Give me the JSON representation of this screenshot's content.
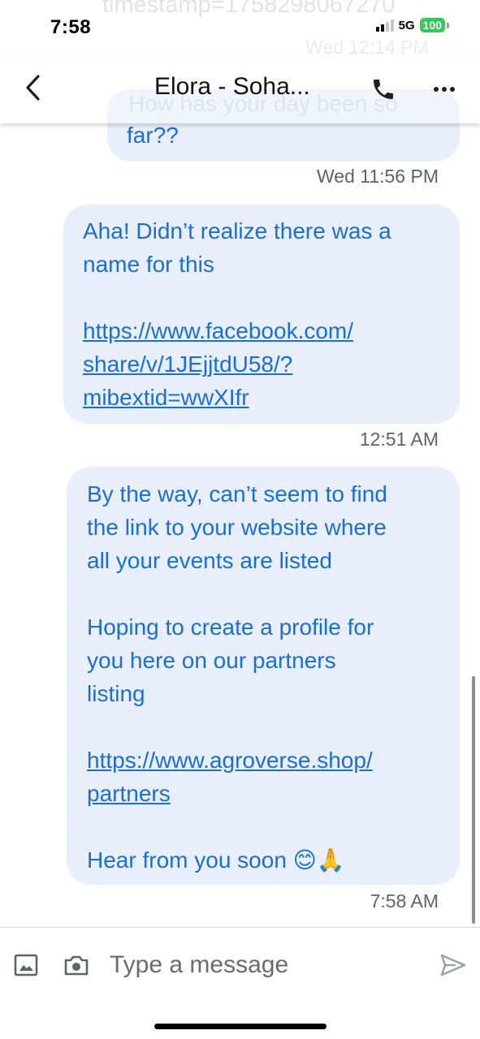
{
  "status_bar": {
    "time": "7:58",
    "network": "5G",
    "battery": "100"
  },
  "background_text": {
    "line1": "timestamp=1758298067270",
    "line2": "Wed 12:14 PM",
    "line3": "How has your day been so"
  },
  "header": {
    "title": "Elora - Soha..."
  },
  "messages": [
    {
      "tail_text": "far??",
      "timestamp": "Wed 11:56 PM"
    },
    {
      "line1": "Aha! Didn’t realize there was a",
      "line2": "name for this",
      "link_line1": "https://www.facebook.com/",
      "link_line2": "share/v/1JEjjtdU58/?",
      "link_line3": "mibextid=wwXIfr",
      "timestamp": "12:51 AM"
    },
    {
      "line1": "By the way, can’t seem to find",
      "line2": "the link to your website where",
      "line3": "all your events are listed",
      "line4": "Hoping to create a profile for",
      "line5": "you here on our partners",
      "line6": "listing",
      "link_line1": "https://www.agroverse.shop/",
      "link_line2": "partners",
      "line7": "Hear from you soon 😊🙏",
      "timestamp": "7:58 AM"
    }
  ],
  "composer": {
    "placeholder": "Type a message"
  },
  "colors": {
    "bubble_bg": "#e8effb",
    "bubble_text": "#1b6fd1",
    "timestamp": "#5f6368",
    "battery": "#34c759"
  },
  "icons": {
    "back": "chevron-left-icon",
    "call": "phone-icon",
    "more": "more-horizontal-icon",
    "gallery": "image-icon",
    "camera": "camera-icon",
    "send": "send-icon"
  }
}
